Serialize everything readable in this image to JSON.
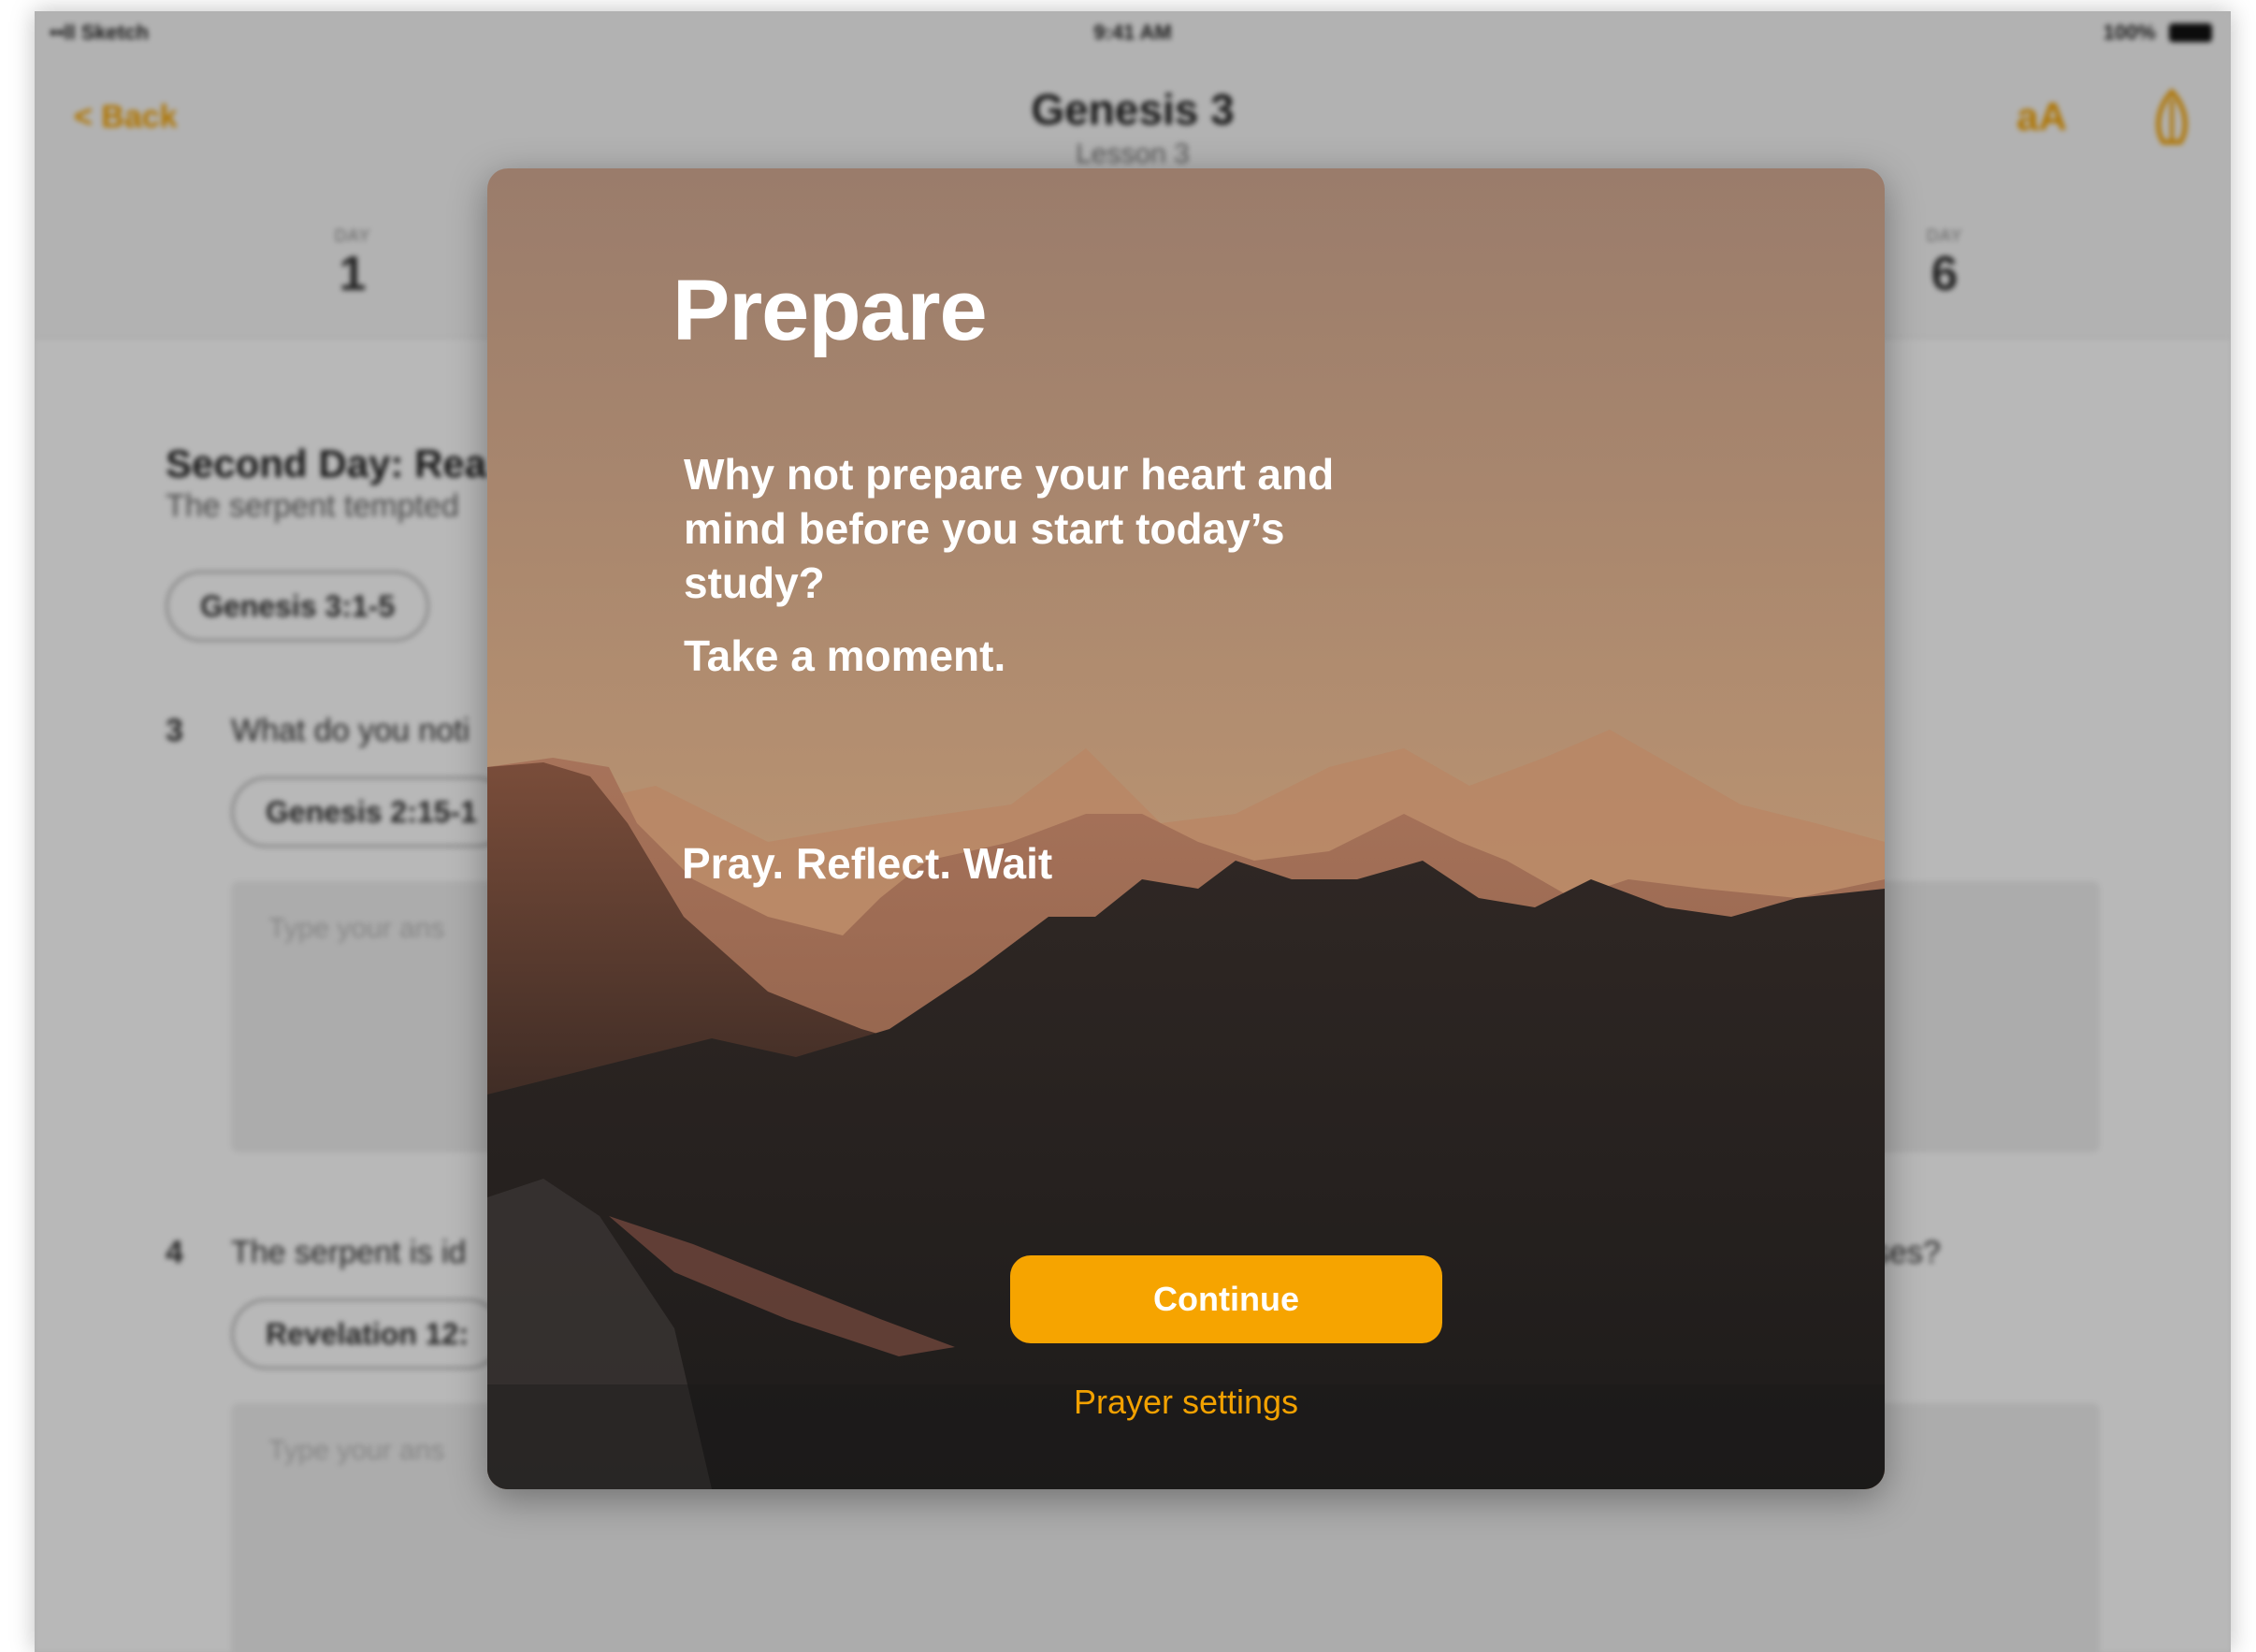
{
  "status_bar": {
    "carrier": "••ll Sketch",
    "time": "9:41 AM",
    "battery": "100%"
  },
  "nav": {
    "back_label": "< Back",
    "title": "Genesis 3",
    "subtitle": "Lesson 3",
    "font_icon_label": "aA"
  },
  "days": [
    {
      "small": "DAY",
      "number": "1"
    },
    {
      "small": "DAY",
      "number": "6"
    }
  ],
  "content": {
    "section_title": "Second Day: Rea",
    "section_sub": "The serpent tempted",
    "pill_1": "Genesis 3:1-5",
    "question_3_num": "3",
    "question_3_text": "What do you noti",
    "pill_2": "Genesis 2:15-1",
    "answer_placeholder_1": "Type your ans",
    "question_4_num": "4",
    "question_4_text": "The serpent is id",
    "question_4_end": "ses?",
    "pill_3": "Revelation 12:",
    "answer_placeholder_2": "Type your ans"
  },
  "modal": {
    "title": "Prepare",
    "body": "Why not prepare your heart and mind before you start today’s study?",
    "moment": "Take a moment.",
    "tagline": "Pray. Reflect. Wait",
    "continue_label": "Continue",
    "settings_label": "Prayer settings"
  },
  "colors": {
    "accent": "#f6a400",
    "accent_text": "#f2a100",
    "sky_top": "#9a7c6b",
    "sky_bottom": "#c89e76",
    "mountain_dark": "#2a2624"
  }
}
